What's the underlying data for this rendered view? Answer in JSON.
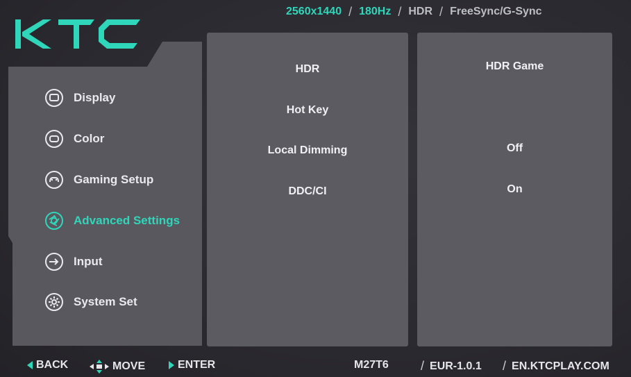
{
  "status": {
    "resolution": "2560x1440",
    "refresh_rate": "180Hz",
    "hdr": "HDR",
    "sync": "FreeSync/G-Sync"
  },
  "logo": {
    "text": "KTC"
  },
  "menu": {
    "items": [
      {
        "label": "Display",
        "icon": "monitor-icon"
      },
      {
        "label": "Color",
        "icon": "color-icon"
      },
      {
        "label": "Gaming Setup",
        "icon": "gamepad-icon"
      },
      {
        "label": "Advanced Settings",
        "icon": "aperture-icon",
        "active": true
      },
      {
        "label": "Input",
        "icon": "input-icon"
      },
      {
        "label": "System Set",
        "icon": "gear-icon"
      }
    ]
  },
  "options": {
    "items": [
      {
        "label": "HDR",
        "value": "HDR Game"
      },
      {
        "label": "Hot Key",
        "value": ""
      },
      {
        "label": "Local Dimming",
        "value": "Off"
      },
      {
        "label": "DDC/CI",
        "value": "On"
      }
    ]
  },
  "footer": {
    "back": "BACK",
    "move": "MOVE",
    "enter": "ENTER",
    "model": "M27T6",
    "firmware": "EUR-1.0.1",
    "website": "EN.KTCPLAY.COM"
  },
  "colors": {
    "accent": "#2fd6b9",
    "panel": "#5d5b62",
    "background": "#2b2a30"
  }
}
